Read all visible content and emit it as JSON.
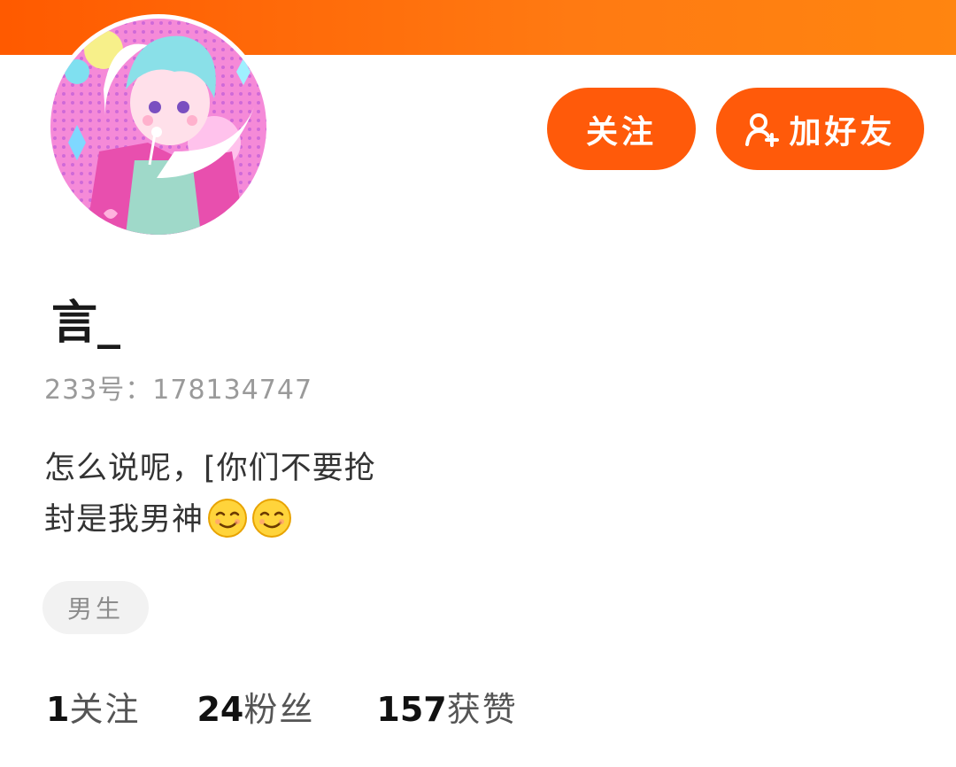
{
  "header": {
    "bar_color": "#ff6a00"
  },
  "profile": {
    "avatar_icon": "anime-avatar",
    "username": "言_",
    "uid_label": "233号：",
    "uid_value": "178134747",
    "bio_line1": "怎么说呢，[你们不要抢",
    "bio_line2": "封是我男神",
    "bio_emoji": "smirk-face-icon",
    "gender_tag": "男生"
  },
  "actions": {
    "follow_label": "关注",
    "add_friend_label": "加好友",
    "add_friend_icon": "add-user-icon",
    "accent_color": "#ff5a0a"
  },
  "stats": [
    {
      "value": "1",
      "label": "关注"
    },
    {
      "value": "24",
      "label": "粉丝"
    },
    {
      "value": "157",
      "label": "获赞"
    }
  ]
}
